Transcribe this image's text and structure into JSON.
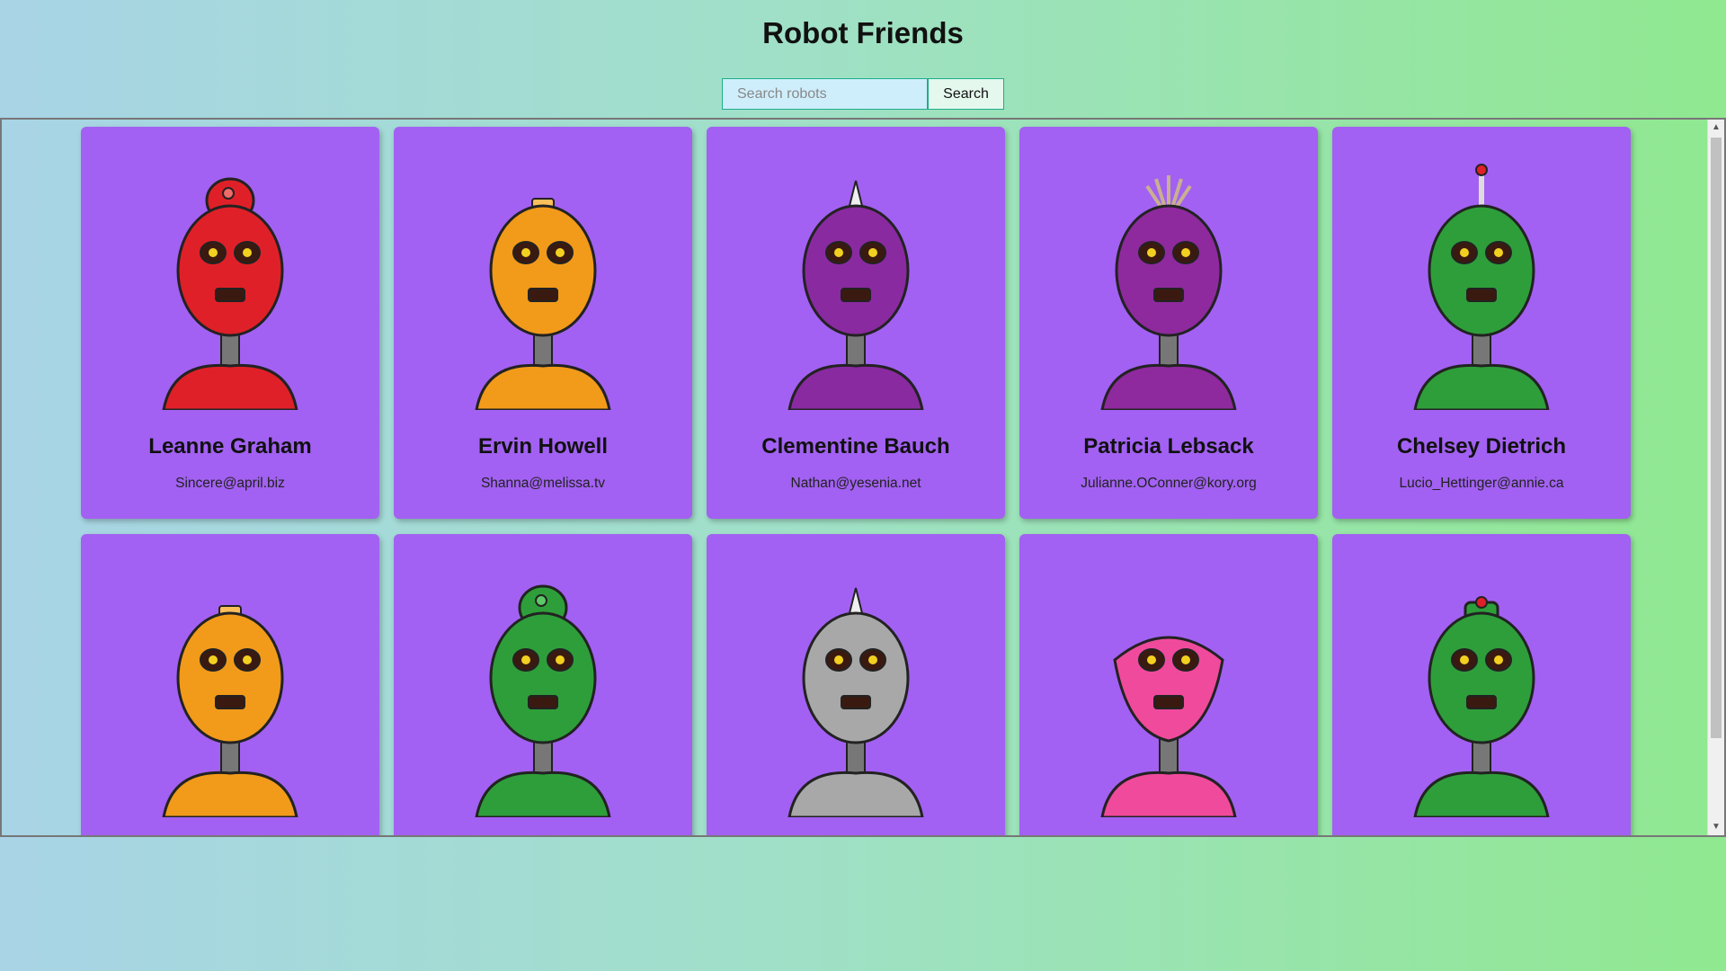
{
  "app": {
    "title": "Robot Friends"
  },
  "search": {
    "placeholder": "Search robots",
    "button_label": "Search"
  },
  "robots": [
    {
      "name": "Leanne Graham",
      "email": "Sincere@april.biz",
      "color": "#e02028",
      "accent": "#f06a6a",
      "head": "egg-dome"
    },
    {
      "name": "Ervin Howell",
      "email": "Shanna@melissa.tv",
      "color": "#f29a1a",
      "accent": "#fbbf5c",
      "head": "oval"
    },
    {
      "name": "Clementine Bauch",
      "email": "Nathan@yesenia.net",
      "color": "#8a2aa0",
      "accent": "#b45cc8",
      "head": "spike"
    },
    {
      "name": "Patricia Lebsack",
      "email": "Julianne.OConner@kory.org",
      "color": "#8e2a9e",
      "accent": "#b860c8",
      "head": "bucket"
    },
    {
      "name": "Chelsey Dietrich",
      "email": "Lucio_Hettinger@annie.ca",
      "color": "#2e9e3a",
      "accent": "#5cc868",
      "head": "antenna"
    },
    {
      "name": "",
      "email": "",
      "color": "#f29a1a",
      "accent": "#fbbf5c",
      "head": "oval"
    },
    {
      "name": "",
      "email": "",
      "color": "#2e9e3a",
      "accent": "#5cc868",
      "head": "dome"
    },
    {
      "name": "",
      "email": "",
      "color": "#a8a8a8",
      "accent": "#d0d0d0",
      "head": "spike"
    },
    {
      "name": "",
      "email": "",
      "color": "#f04a9c",
      "accent": "#f78cc2",
      "head": "triangle"
    },
    {
      "name": "",
      "email": "",
      "color": "#2e9e3a",
      "accent": "#5cc868",
      "head": "hat"
    }
  ]
}
